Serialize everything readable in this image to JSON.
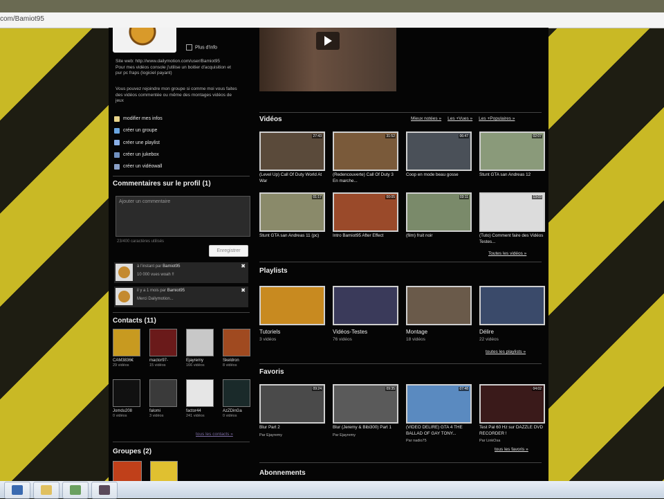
{
  "browser": {
    "url": "com/Bamiot95"
  },
  "profile": {
    "more_info": "Plus d'info",
    "site_web": "Site web: http://www.dailymotion.com/user/Bamiot95",
    "site_line2": "Pour mes vidéos console j'utilise un boitier d'acquisition et",
    "site_line3": "pur pc fraps (logiciel payant)",
    "desc_line1": "Vous pouvez rejoindre mon groupe si comme moi vous faites",
    "desc_line2": "des vidéos commentée ou même des montages vidéos de",
    "desc_line3": "jeux",
    "actions": [
      {
        "label": "modifier mes infos",
        "icon": "pencil-icon",
        "color": "#e8d48a"
      },
      {
        "label": "créer un groupe",
        "icon": "group-icon",
        "color": "#6aa5e0"
      },
      {
        "label": "créer une playlist",
        "icon": "playlist-icon",
        "color": "#8ab0e8"
      },
      {
        "label": "créer un jukebox",
        "icon": "jukebox-icon",
        "color": "#7090c0"
      },
      {
        "label": "créer un vidéowall",
        "icon": "videowall-icon",
        "color": "#8aa0c8"
      }
    ]
  },
  "comments": {
    "title": "Commentaires sur le profil (1)",
    "placeholder": "Ajouter un commentaire",
    "counter": "23/400 caractères utilisés",
    "save_label": "Enregistrer",
    "items": [
      {
        "meta": "à l'instant par",
        "author": "Bamiot95",
        "text": "10 000 vues woah !!"
      },
      {
        "meta": "il y a 1 mois par",
        "author": "Bamiot95",
        "text": "Merci Dailymotion..."
      }
    ]
  },
  "contacts": {
    "title": "Contacts (11)",
    "items": [
      {
        "name": "CAM3836€",
        "count": "29 vidéos",
        "color": "#c89a20"
      },
      {
        "name": "mactor97-",
        "count": "15 vidéos",
        "color": "#6a1a1a"
      },
      {
        "name": "Ejayremy",
        "count": "166 vidéos",
        "color": "#c8c8c8"
      },
      {
        "name": "Skeldron",
        "count": "8 vidéos",
        "color": "#a04a20"
      },
      {
        "name": "Jomdu208",
        "count": "0 vidéos",
        "color": "#111111"
      },
      {
        "name": "falomi",
        "count": "3 vidéos",
        "color": "#3a3a3a"
      },
      {
        "name": "factor44",
        "count": "241 vidéos",
        "color": "#e6e6e6"
      },
      {
        "name": "AzZDinGa",
        "count": "0 vidéos",
        "color": "#1a2a2a"
      }
    ],
    "all_link": "tous les contacts »"
  },
  "groups": {
    "title": "Groupes (2)"
  },
  "videos": {
    "title": "Vidéos",
    "sort_links": [
      "Mieux notées »",
      "Les +Vues »",
      "Les +Populaires »"
    ],
    "items": [
      {
        "title": "(Level Up) Call Of Duty World At War",
        "duration": "27:43",
        "color": "#5a4a3a"
      },
      {
        "title": "(Redencouverte) Call Of Duty 3 En marche...",
        "duration": "31:52",
        "color": "#7a5a3a"
      },
      {
        "title": "Coop en mode beau gosse",
        "duration": "06:47",
        "color": "#4a5058"
      },
      {
        "title": "Stunt GTA san Andreas 12",
        "duration": "02:07",
        "color": "#8a9a7a"
      },
      {
        "title": "Stunt GTA san Andreas 11 (pc)",
        "duration": "01:17",
        "color": "#8a8a6a"
      },
      {
        "title": "Intro Bamiot95 After Effect",
        "duration": "00:05",
        "color": "#9a4a2a"
      },
      {
        "title": "(film) fruit noir",
        "duration": "03:11",
        "color": "#7a8a6a"
      },
      {
        "title": "(Tuto) Comment faire des Vidéos Testes...",
        "duration": "13:03",
        "color": "#dcdcdc"
      }
    ],
    "all_link": "Toutes les vidéos »"
  },
  "playlists": {
    "title": "Playlists",
    "items": [
      {
        "name": "Tutoriels",
        "count": "3 vidéos",
        "color": "#c88a20"
      },
      {
        "name": "Vidéos-Testes",
        "count": "76 vidéos",
        "color": "#3a3a5a"
      },
      {
        "name": "Montage",
        "count": "18 vidéos",
        "color": "#6a5a4a"
      },
      {
        "name": "Délire",
        "count": "22 vidéos",
        "color": "#3a4a6a"
      }
    ],
    "all_link": "toutes les playlists »"
  },
  "favorites": {
    "title": "Favoris",
    "items": [
      {
        "title": "Blur Part 2",
        "by": "Par Ejayremy",
        "duration": "09:24",
        "color": "#4a4a4a"
      },
      {
        "title": "Blur (Jeremy & Bibi300) Part 1",
        "by": "Par Ejayremy",
        "duration": "09:35",
        "color": "#5a5a5a"
      },
      {
        "title": "(VIDEO DELIRE) GTA 4 THE BALLAD OF GAY TONY...",
        "by": "Par nadio75",
        "duration": "07:48",
        "color": "#5a8ac0"
      },
      {
        "title": "Test Pal 60 Hz sur DAZZLE DVD RECORDER !",
        "by": "Par LinkOsa",
        "duration": "04:02",
        "color": "#3a1a1a"
      }
    ],
    "all_link": "tous les favoris »"
  },
  "subscriptions": {
    "title": "Abonnements"
  },
  "taskbar": {
    "items": [
      {
        "icon": "start-icon",
        "color": "#3a6ab0"
      },
      {
        "icon": "explorer-icon",
        "color": "#e0c060"
      },
      {
        "icon": "network-icon",
        "color": "#6aa060"
      },
      {
        "icon": "app-icon",
        "color": "#5a4a5a"
      }
    ]
  }
}
